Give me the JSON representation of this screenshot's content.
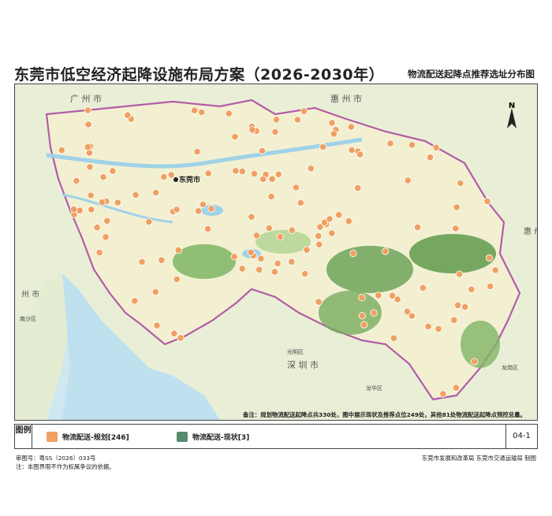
{
  "header": {
    "title": "东莞市低空经济起降设施布局方案（2026-2030年）",
    "subtitle": "物流配送起降点推荐选址分布图"
  },
  "map": {
    "north_label": "N",
    "region_labels": {
      "guangzhou": "广 州 市",
      "huizhou": "惠 州 市",
      "shenzhen": "深 圳 市",
      "huizhou_east": "惠 州 市",
      "zhongshan": "州 市",
      "city_center": "东莞市",
      "nansha": "南沙区",
      "guangming": "光明区",
      "longgang": "龙岗区",
      "longhua": "龙华区"
    },
    "note": "备注：规划物流配送起降点共330处，图中展示现状及推荐点位249处，其他81处物流配送起降点预控总量。"
  },
  "legend": {
    "title": "图例",
    "planned_label": "物流配送-规划[246]",
    "existing_label": "物流配送-现状[3]",
    "planned_color": "#f0a060",
    "existing_color": "#5a8a70",
    "map_id": "04-1"
  },
  "footer": {
    "review_no": "审图号：粤SS（2026）033号",
    "disclaimer": "注：本图界限不作为权属争议的依据。",
    "producer": "东莞市发展和改革局  东莞市交通运输局  制图"
  },
  "colors": {
    "land": "#f3f0d2",
    "water": "#bfe0ee",
    "forest": "#6fa35a",
    "boundary": "#b35ca6",
    "point": "#f0a060"
  }
}
